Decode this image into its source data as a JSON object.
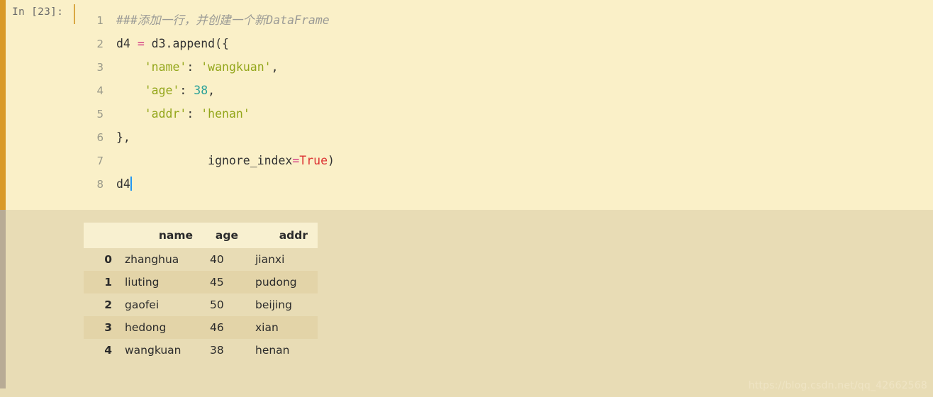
{
  "cell": {
    "prompt_label": "In [23]:",
    "code_lines": [
      {
        "number": "1",
        "tokens": [
          {
            "kind": "comment",
            "text": "###添加一行，并创建一个新DataFrame"
          }
        ]
      },
      {
        "number": "2",
        "tokens": [
          {
            "kind": "plain",
            "text": "d4 "
          },
          {
            "kind": "op",
            "text": "="
          },
          {
            "kind": "plain",
            "text": " d3.append({"
          }
        ]
      },
      {
        "number": "3",
        "tokens": [
          {
            "kind": "plain",
            "text": "    "
          },
          {
            "kind": "str",
            "text": "'name'"
          },
          {
            "kind": "plain",
            "text": ": "
          },
          {
            "kind": "str",
            "text": "'wangkuan'"
          },
          {
            "kind": "plain",
            "text": ","
          }
        ]
      },
      {
        "number": "4",
        "tokens": [
          {
            "kind": "plain",
            "text": "    "
          },
          {
            "kind": "str",
            "text": "'age'"
          },
          {
            "kind": "plain",
            "text": ": "
          },
          {
            "kind": "num",
            "text": "38"
          },
          {
            "kind": "plain",
            "text": ","
          }
        ]
      },
      {
        "number": "5",
        "tokens": [
          {
            "kind": "plain",
            "text": "    "
          },
          {
            "kind": "str",
            "text": "'addr'"
          },
          {
            "kind": "plain",
            "text": ": "
          },
          {
            "kind": "str",
            "text": "'henan'"
          }
        ]
      },
      {
        "number": "6",
        "tokens": [
          {
            "kind": "plain",
            "text": "},"
          }
        ]
      },
      {
        "number": "7",
        "tokens": [
          {
            "kind": "plain",
            "text": "             ignore_index"
          },
          {
            "kind": "op",
            "text": "="
          },
          {
            "kind": "kw",
            "text": "True"
          },
          {
            "kind": "plain",
            "text": ")"
          }
        ]
      },
      {
        "number": "8",
        "tokens": [
          {
            "kind": "plain",
            "text": "d4"
          }
        ],
        "caret": true
      }
    ]
  },
  "output": {
    "table": {
      "index_header": "",
      "columns": [
        "name",
        "age",
        "addr"
      ],
      "rows": [
        {
          "index": "0",
          "name": "zhanghua",
          "age": "40",
          "addr": "jianxi"
        },
        {
          "index": "1",
          "name": "liuting",
          "age": "45",
          "addr": "pudong"
        },
        {
          "index": "2",
          "name": "gaofei",
          "age": "50",
          "addr": "beijing"
        },
        {
          "index": "3",
          "name": "hedong",
          "age": "46",
          "addr": "xian"
        },
        {
          "index": "4",
          "name": "wangkuan",
          "age": "38",
          "addr": "henan"
        }
      ]
    }
  },
  "watermark": {
    "text": "https://blog.csdn.net/qq_42662568"
  },
  "colors": {
    "input_background": "#faf0c8",
    "output_background": "#e8dcb5",
    "input_accent_bar": "#d99a27",
    "output_accent_bar": "#b8ab95",
    "table_header_background": "#f8f0d0",
    "table_stripe_background": "#e3d4a8",
    "string_token": "#93a61a",
    "number_token": "#2aa198",
    "operator_token": "#d33682",
    "keyword_token": "#dc3232",
    "comment_token": "#9b9b96",
    "caret": "#2196f3"
  }
}
